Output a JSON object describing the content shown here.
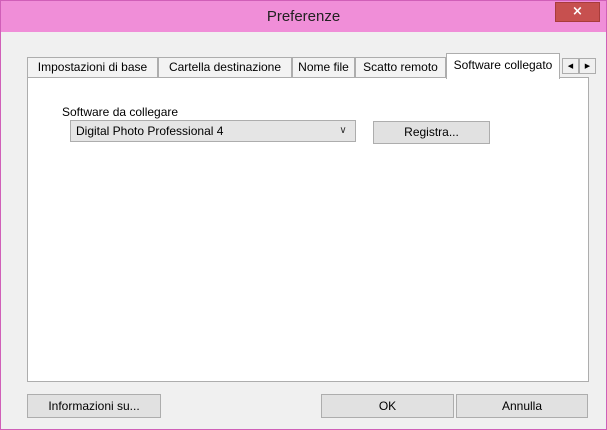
{
  "window": {
    "title": "Preferenze",
    "close_glyph": "×",
    "titlebar_color": "#f08ed8",
    "border_color": "#d05fb8",
    "close_color": "#c7504f"
  },
  "tabs": [
    {
      "label": "Impostazioni di base",
      "active": false
    },
    {
      "label": "Cartella destinazione",
      "active": false
    },
    {
      "label": "Nome file",
      "active": false
    },
    {
      "label": "Scatto remoto",
      "active": false
    },
    {
      "label": "Software collegato",
      "active": true
    }
  ],
  "tab_scroll": {
    "left_icon": "triangle-left-icon",
    "right_icon": "triangle-right-icon",
    "left_glyph": "◀",
    "right_glyph": "▶"
  },
  "linked_software": {
    "section_label": "Software da collegare",
    "selected_value": "Digital Photo Professional 4",
    "dropdown_icon": "chevron-down-icon",
    "dropdown_glyph": "∨",
    "register_label": "Registra..."
  },
  "footer": {
    "about_label": "Informazioni su...",
    "ok_label": "OK",
    "cancel_label": "Annulla"
  }
}
